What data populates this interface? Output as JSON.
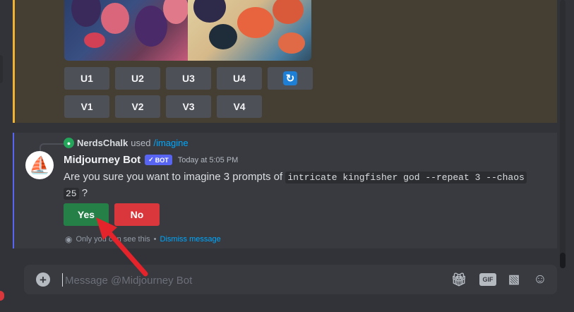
{
  "image_buttons": {
    "upscale": [
      "U1",
      "U2",
      "U3",
      "U4"
    ],
    "variation": [
      "V1",
      "V2",
      "V3",
      "V4"
    ],
    "refresh_icon": "refresh-icon"
  },
  "reply": {
    "user": "NerdsChalk",
    "action": "used",
    "command": "/imagine"
  },
  "message": {
    "author": "Midjourney Bot",
    "bot_tag": "BOT",
    "timestamp": "Today at 5:05 PM",
    "text_prefix": "Are you sure you want to imagine 3 prompts of",
    "code_part1": "intricate kingfisher god --repeat 3 --chaos",
    "code_part2": "25",
    "text_suffix": "?"
  },
  "choices": {
    "yes": "Yes",
    "no": "No"
  },
  "ephemeral": {
    "note": "Only you can see this",
    "separator": "•",
    "dismiss": "Dismiss message"
  },
  "composer": {
    "placeholder": "Message @Midjourney Bot",
    "gif_label": "GIF"
  },
  "colors": {
    "blurple": "#5865f2",
    "success": "#248046",
    "danger": "#da373c",
    "link": "#00a8fc",
    "highlight": "#f0b232"
  }
}
